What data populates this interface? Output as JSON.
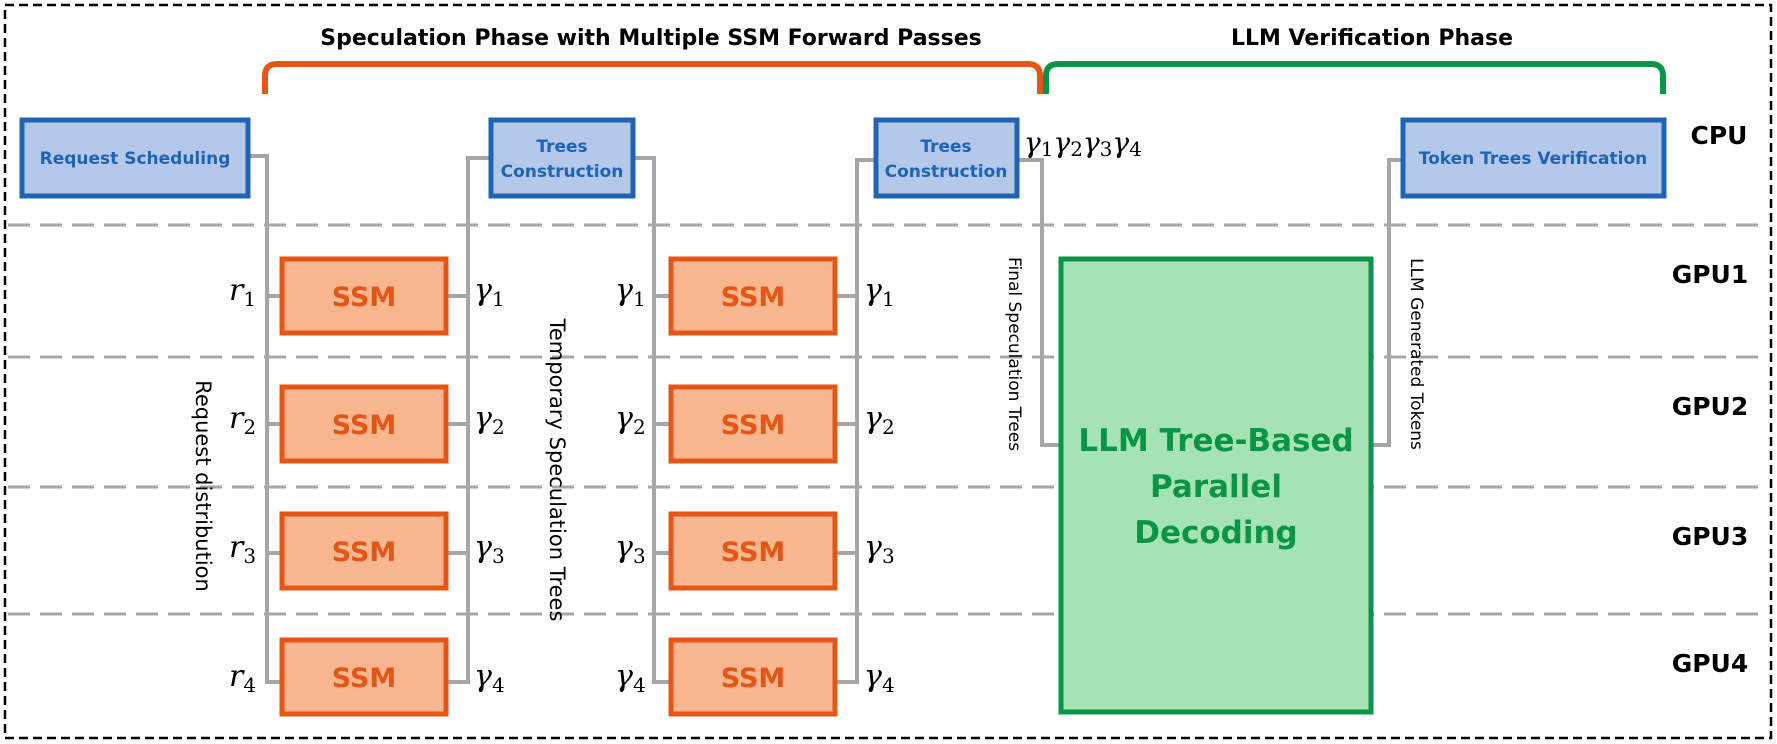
{
  "phases": {
    "speculation": {
      "title": "Speculation Phase with Multiple SSM Forward Passes",
      "color": "#e45615"
    },
    "verification": {
      "title": "LLM Verification Phase",
      "color": "#0a9447"
    }
  },
  "lanes": [
    "CPU",
    "GPU1",
    "GPU2",
    "GPU3",
    "GPU4"
  ],
  "cpu_boxes": {
    "request_scheduling": "Request Scheduling",
    "trees_construction_1": [
      "Trees",
      "Construction"
    ],
    "trees_construction_2": [
      "Trees",
      "Construction"
    ],
    "token_trees_verification": "Token Trees Verification"
  },
  "ssm_label": "SSM",
  "llm_box": [
    "LLM Tree-Based",
    "Parallel",
    "Decoding"
  ],
  "inputs": {
    "requests": [
      {
        "base": "r",
        "sub": "1"
      },
      {
        "base": "r",
        "sub": "2"
      },
      {
        "base": "r",
        "sub": "3"
      },
      {
        "base": "r",
        "sub": "4"
      }
    ],
    "gammas": [
      {
        "base": "γ",
        "sub": "1"
      },
      {
        "base": "γ",
        "sub": "2"
      },
      {
        "base": "γ",
        "sub": "3"
      },
      {
        "base": "γ",
        "sub": "4"
      }
    ]
  },
  "gamma_sequence": "γ1γ2γ3γ4",
  "edge_labels": {
    "request_distribution": "Request distribution",
    "temporary_trees": "Temporary Speculation Trees",
    "final_trees": "Final Speculation Trees",
    "llm_tokens": "LLM Generated Tokens"
  },
  "colors": {
    "cpu_box_fill": "#b4c8e9",
    "cpu_box_border": "#1f63b5",
    "ssm_fill": "#f7b690",
    "ssm_border": "#e45615",
    "llm_fill": "#a6e3b4",
    "llm_border": "#0a9447",
    "wire": "#a6a6a6"
  }
}
